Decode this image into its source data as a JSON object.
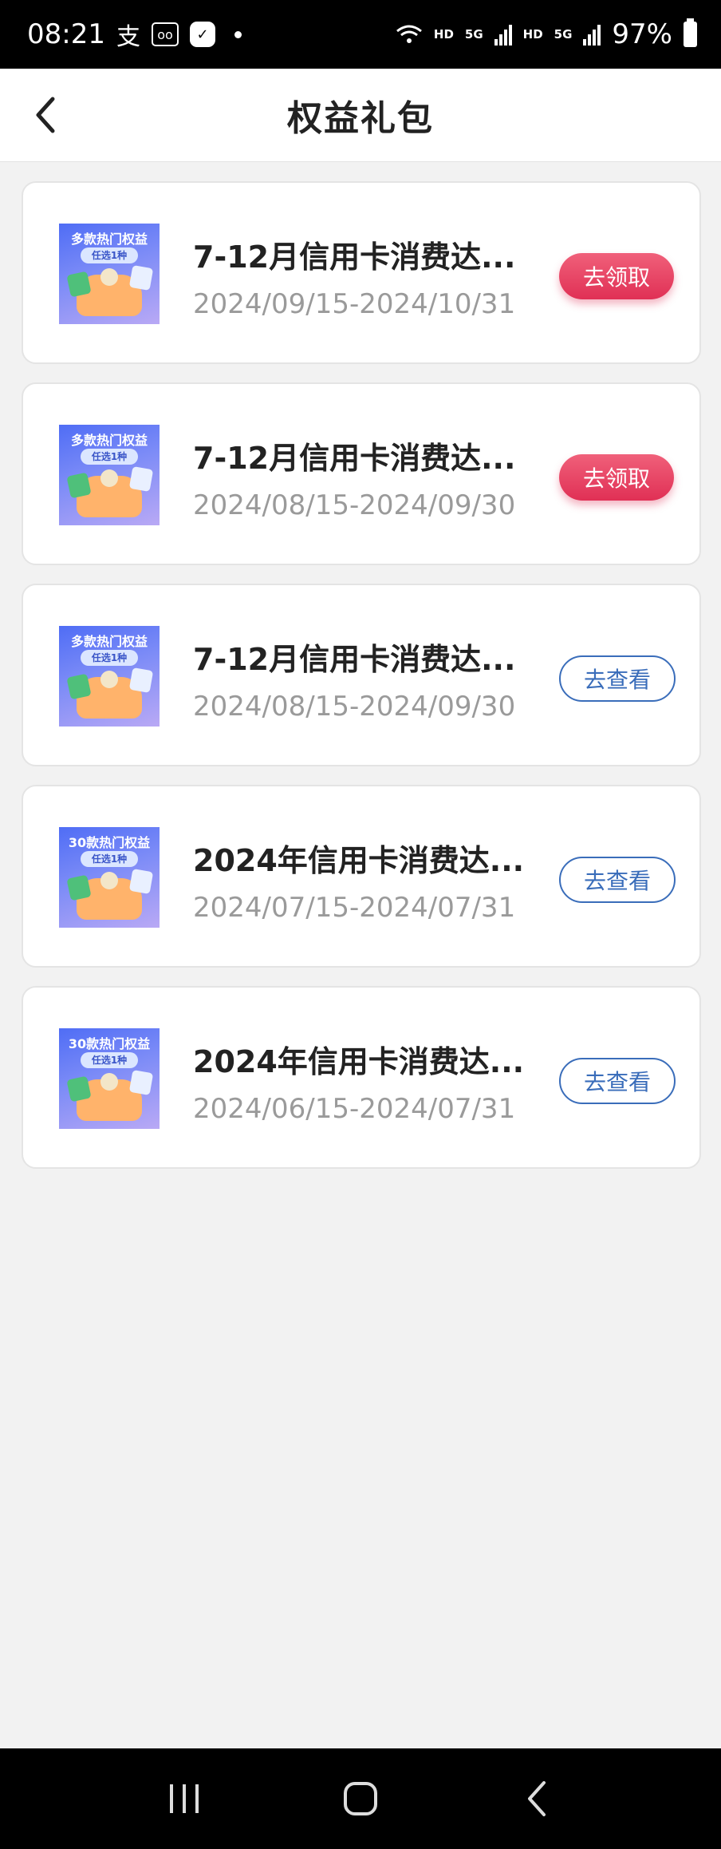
{
  "status_bar": {
    "time": "08:21",
    "icons": [
      "alipay-icon",
      "voicemail-icon",
      "app-icon",
      "dot-icon"
    ],
    "network": [
      "HD",
      "5G",
      "HD",
      "5G"
    ],
    "battery": "97%"
  },
  "header": {
    "title": "权益礼包",
    "back_icon": "chevron-left-icon"
  },
  "cards": [
    {
      "thumb_title": "多款热门权益",
      "thumb_pill": "任选1种",
      "title": "7-12月信用卡消费达...",
      "date": "2024/09/15-2024/10/31",
      "button": "去领取",
      "button_type": "claim"
    },
    {
      "thumb_title": "多款热门权益",
      "thumb_pill": "任选1种",
      "title": "7-12月信用卡消费达...",
      "date": "2024/08/15-2024/09/30",
      "button": "去领取",
      "button_type": "claim"
    },
    {
      "thumb_title": "多款热门权益",
      "thumb_pill": "任选1种",
      "title": "7-12月信用卡消费达...",
      "date": "2024/08/15-2024/09/30",
      "button": "去查看",
      "button_type": "view"
    },
    {
      "thumb_title": "30款热门权益",
      "thumb_pill": "任选1种",
      "title": "2024年信用卡消费达...",
      "date": "2024/07/15-2024/07/31",
      "button": "去查看",
      "button_type": "view"
    },
    {
      "thumb_title": "30款热门权益",
      "thumb_pill": "任选1种",
      "title": "2024年信用卡消费达...",
      "date": "2024/06/15-2024/07/31",
      "button": "去查看",
      "button_type": "view"
    }
  ],
  "colors": {
    "claim_button": "#e03055",
    "view_button": "#3a6dba",
    "background": "#f2f2f2"
  },
  "nav_bar": {
    "buttons": [
      "recent-apps-icon",
      "home-icon",
      "back-icon"
    ]
  }
}
